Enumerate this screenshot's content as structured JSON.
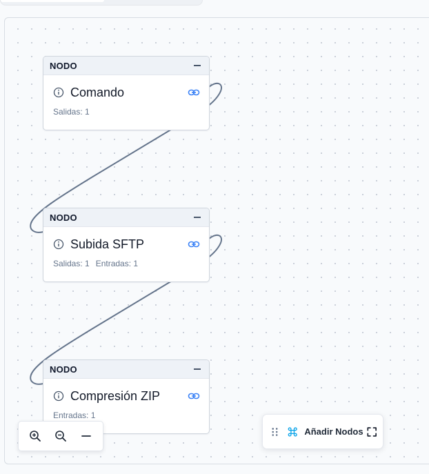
{
  "nodes": [
    {
      "tag": "NODO",
      "title": "Comando",
      "outputs": "Salidas: 1",
      "inputs": ""
    },
    {
      "tag": "NODO",
      "title": "Subida SFTP",
      "outputs": "Salidas: 1",
      "inputs": "Entradas: 1"
    },
    {
      "tag": "NODO",
      "title": "Compresión ZIP",
      "outputs": "",
      "inputs": "Entradas: 1"
    }
  ],
  "toolbar": {
    "add_nodes_label": "Añadir Nodos"
  },
  "zoom": {
    "zoom_in_icon": "zoom-in-icon",
    "zoom_out_icon": "zoom-out-icon",
    "fit_icon": "minus-icon"
  },
  "colors": {
    "edge": "#64748b",
    "link_icon": "#3b82f6",
    "command_icon": "#0ea5e9"
  }
}
